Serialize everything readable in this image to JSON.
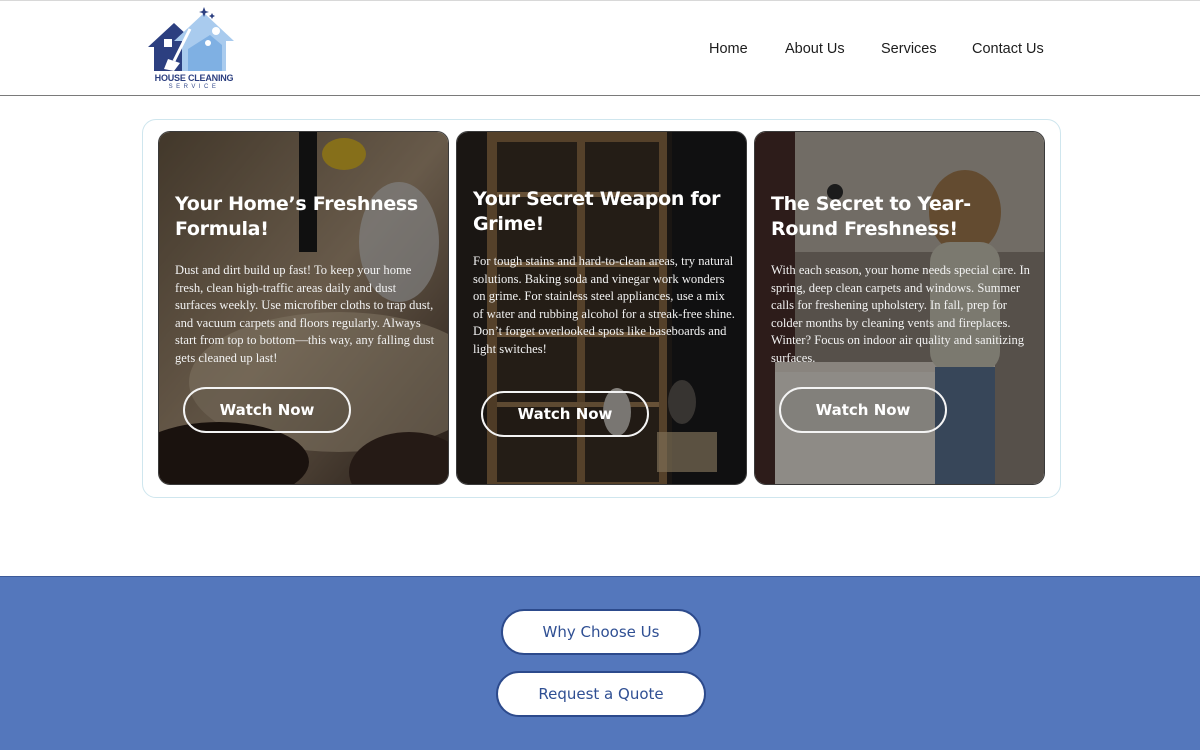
{
  "brand": {
    "name": "HOUSE CLEANING",
    "tagline": "SERVICE",
    "colors": {
      "primary": "#2c3f80",
      "accent": "#5477bc",
      "light": "#9fc3ea"
    }
  },
  "nav": {
    "items": [
      {
        "label": "Home"
      },
      {
        "label": "About Us"
      },
      {
        "label": "Services"
      },
      {
        "label": "Contact Us"
      }
    ]
  },
  "cards": [
    {
      "title": "Your Home’s Freshness Formula!",
      "body": "Dust and dirt build up fast! To keep your home fresh, clean high-traffic areas daily and dust surfaces weekly. Use microfiber cloths to trap dust, and vacuum carpets and floors regularly. Always start from top to bottom—this way, any falling dust gets cleaned up last!",
      "button": "Watch Now"
    },
    {
      "title": "Your Secret Weapon for Grime!",
      "body": "For tough stains and hard-to-clean areas, try natural solutions. Baking soda and vinegar work wonders on grime. For stainless steel appliances, use a mix of water and rubbing alcohol for a streak-free shine. Don’t forget overlooked spots like baseboards and light switches!",
      "button": "Watch Now"
    },
    {
      "title": "The Secret to Year-Round Freshness!",
      "body": "With each season, your home needs special care. In spring, deep clean carpets and windows. Summer calls for freshening upholstery. In fall, prep for colder months by cleaning vents and fireplaces. Winter? Focus on indoor air quality and sanitizing surfaces.",
      "button": "Watch Now"
    }
  ],
  "footer": {
    "why_label": "Why Choose Us",
    "quote_label": "Request a Quote"
  }
}
